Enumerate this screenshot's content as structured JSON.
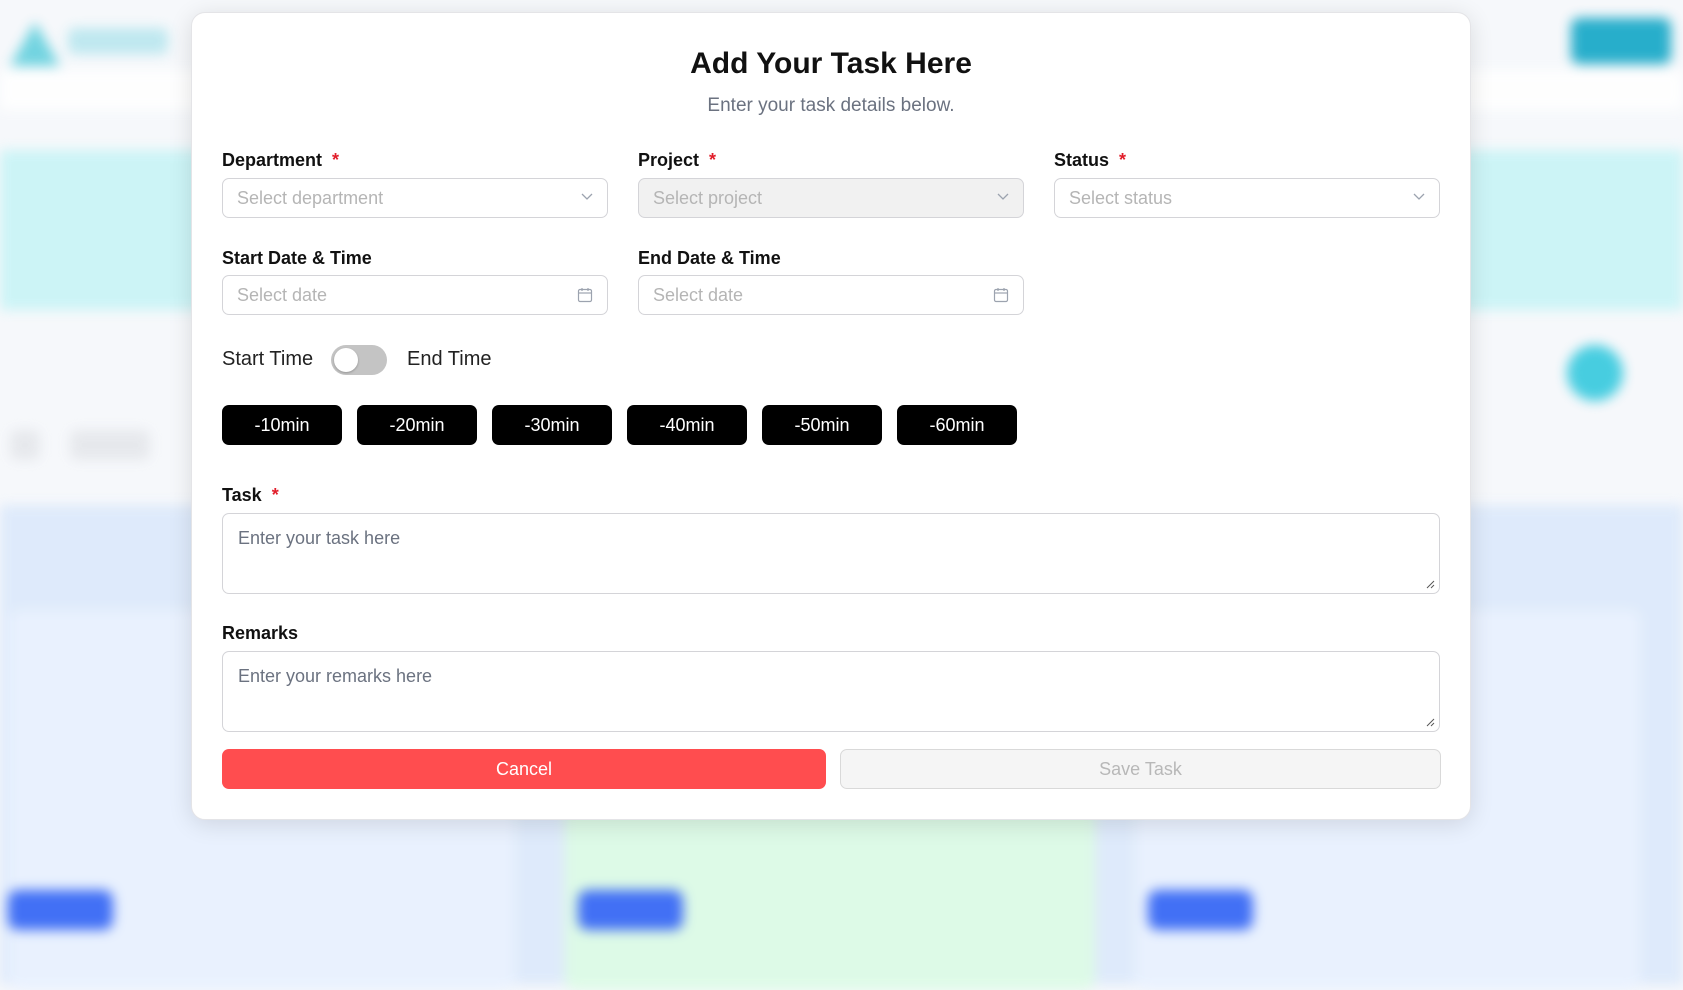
{
  "modal": {
    "title": "Add Your Task Here",
    "subtitle": "Enter your task details below."
  },
  "fields": {
    "department": {
      "label": "Department",
      "required_mark": "*",
      "placeholder": "Select department"
    },
    "project": {
      "label": "Project",
      "required_mark": "*",
      "placeholder": "Select project",
      "disabled": true
    },
    "status": {
      "label": "Status",
      "required_mark": "*",
      "placeholder": "Select status"
    },
    "start_datetime": {
      "label": "Start Date & Time",
      "placeholder": "Select date"
    },
    "end_datetime": {
      "label": "End Date & Time",
      "placeholder": "Select date"
    }
  },
  "time_toggle": {
    "left_label": "Start Time",
    "right_label": "End Time",
    "checked": false
  },
  "quick_buttons": [
    "-10min",
    "-20min",
    "-30min",
    "-40min",
    "-50min",
    "-60min"
  ],
  "task": {
    "label": "Task",
    "required_mark": "*",
    "placeholder": "Enter your task here"
  },
  "remarks": {
    "label": "Remarks",
    "placeholder": "Enter your remarks here"
  },
  "actions": {
    "cancel_label": "Cancel",
    "save_label": "Save Task",
    "save_disabled": true
  },
  "colors": {
    "cancel": "#ff4d4f",
    "quick_button": "#000000",
    "required": "#e11d2a",
    "toggle_off": "#c4c4c4"
  },
  "icons": {
    "select": "chevron-down-icon",
    "date": "calendar-icon",
    "textarea": "resize-handle-icon"
  }
}
